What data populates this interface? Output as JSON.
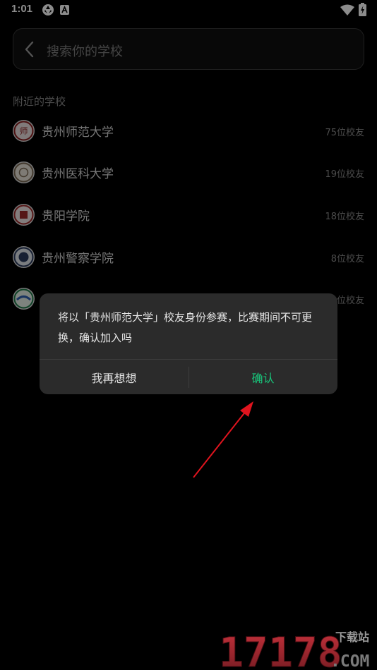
{
  "status_bar": {
    "time": "1:01"
  },
  "search": {
    "placeholder": "搜索你的学校"
  },
  "nearby": {
    "title": "附近的学校",
    "schools": [
      {
        "name": "贵州师范大学",
        "count": "75位校友"
      },
      {
        "name": "贵州医科大学",
        "count": "19位校友"
      },
      {
        "name": "贵阳学院",
        "count": "18位校友"
      },
      {
        "name": "贵州警察学院",
        "count": "8位校友"
      },
      {
        "name": "",
        "count": "位校友"
      }
    ]
  },
  "dialog": {
    "message": "将以「贵州师范大学」校友身份参赛，比赛期间不可更换，确认加入吗",
    "cancel_label": "我再想想",
    "confirm_label": "确认"
  },
  "watermark": {
    "number": "17178",
    "suffix": ".COM",
    "label": "下载站"
  },
  "colors": {
    "accent": "#18c47a",
    "arrow": "#e0141e"
  }
}
